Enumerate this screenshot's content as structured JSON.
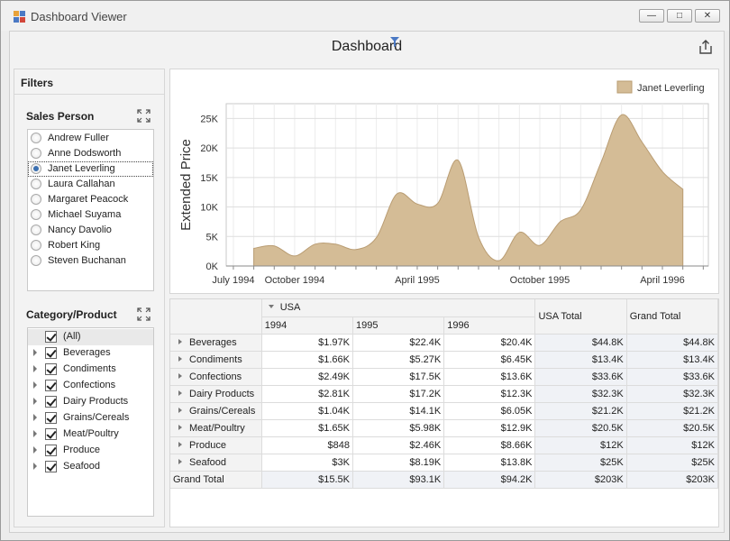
{
  "window": {
    "title": "Dashboard Viewer"
  },
  "dashboard": {
    "title": "Dashboard"
  },
  "filters": {
    "title": "Filters",
    "sales_person": {
      "title": "Sales Person",
      "items": [
        "Andrew Fuller",
        "Anne Dodsworth",
        "Janet Leverling",
        "Laura Callahan",
        "Margaret Peacock",
        "Michael Suyama",
        "Nancy Davolio",
        "Robert King",
        "Steven Buchanan"
      ],
      "selected": "Janet Leverling"
    },
    "category_product": {
      "title": "Category/Product",
      "items": [
        "(All)",
        "Beverages",
        "Condiments",
        "Confections",
        "Dairy Products",
        "Grains/Cereals",
        "Meat/Poultry",
        "Produce",
        "Seafood"
      ]
    }
  },
  "colors": {
    "accent": "#3a6fb0",
    "area_fill": "#d4bc96",
    "area_stroke": "#b99c72"
  },
  "chart_data": {
    "type": "area",
    "ylabel": "Extended Price",
    "legend": {
      "entries": [
        "Janet Leverling"
      ],
      "placement": "top-right"
    },
    "ylim": [
      0,
      27500
    ],
    "y_ticks": [
      0,
      5000,
      10000,
      15000,
      20000,
      25000
    ],
    "y_tick_labels": [
      "0K",
      "5K",
      "10K",
      "15K",
      "20K",
      "25K"
    ],
    "x_tick_labels": [
      "July 1994",
      "October 1994",
      "April 1995",
      "October 1995",
      "April 1996"
    ],
    "xlim": [
      "1994-07",
      "1996-06"
    ],
    "grid": true,
    "series": [
      {
        "name": "Janet Leverling",
        "x": [
          "1994-08",
          "1994-09",
          "1994-10",
          "1994-11",
          "1994-12",
          "1995-01",
          "1995-02",
          "1995-03",
          "1995-04",
          "1995-05",
          "1995-06",
          "1995-07",
          "1995-08",
          "1995-09",
          "1995-10",
          "1995-11",
          "1995-12",
          "1996-01",
          "1996-02",
          "1996-03",
          "1996-04",
          "1996-05"
        ],
        "values": [
          3000,
          3400,
          1700,
          3700,
          3700,
          2800,
          4800,
          12200,
          10500,
          10600,
          17900,
          4900,
          900,
          5700,
          3500,
          7500,
          9500,
          17600,
          25600,
          21000,
          16000,
          13000
        ]
      }
    ]
  },
  "pivot": {
    "country": "USA",
    "years": [
      "1994",
      "1995",
      "1996"
    ],
    "country_total_label": "USA Total",
    "grand_total_label": "Grand Total",
    "rows": [
      {
        "label": "Beverages",
        "values": [
          "$1.97K",
          "$22.4K",
          "$20.4K",
          "$44.8K",
          "$44.8K"
        ]
      },
      {
        "label": "Condiments",
        "values": [
          "$1.66K",
          "$5.27K",
          "$6.45K",
          "$13.4K",
          "$13.4K"
        ]
      },
      {
        "label": "Confections",
        "values": [
          "$2.49K",
          "$17.5K",
          "$13.6K",
          "$33.6K",
          "$33.6K"
        ]
      },
      {
        "label": "Dairy Products",
        "values": [
          "$2.81K",
          "$17.2K",
          "$12.3K",
          "$32.3K",
          "$32.3K"
        ]
      },
      {
        "label": "Grains/Cereals",
        "values": [
          "$1.04K",
          "$14.1K",
          "$6.05K",
          "$21.2K",
          "$21.2K"
        ]
      },
      {
        "label": "Meat/Poultry",
        "values": [
          "$1.65K",
          "$5.98K",
          "$12.9K",
          "$20.5K",
          "$20.5K"
        ]
      },
      {
        "label": "Produce",
        "values": [
          "$848",
          "$2.46K",
          "$8.66K",
          "$12K",
          "$12K"
        ]
      },
      {
        "label": "Seafood",
        "values": [
          "$3K",
          "$8.19K",
          "$13.8K",
          "$25K",
          "$25K"
        ]
      }
    ],
    "grand_total_row": {
      "label": "Grand Total",
      "values": [
        "$15.5K",
        "$93.1K",
        "$94.2K",
        "$203K",
        "$203K"
      ]
    }
  }
}
